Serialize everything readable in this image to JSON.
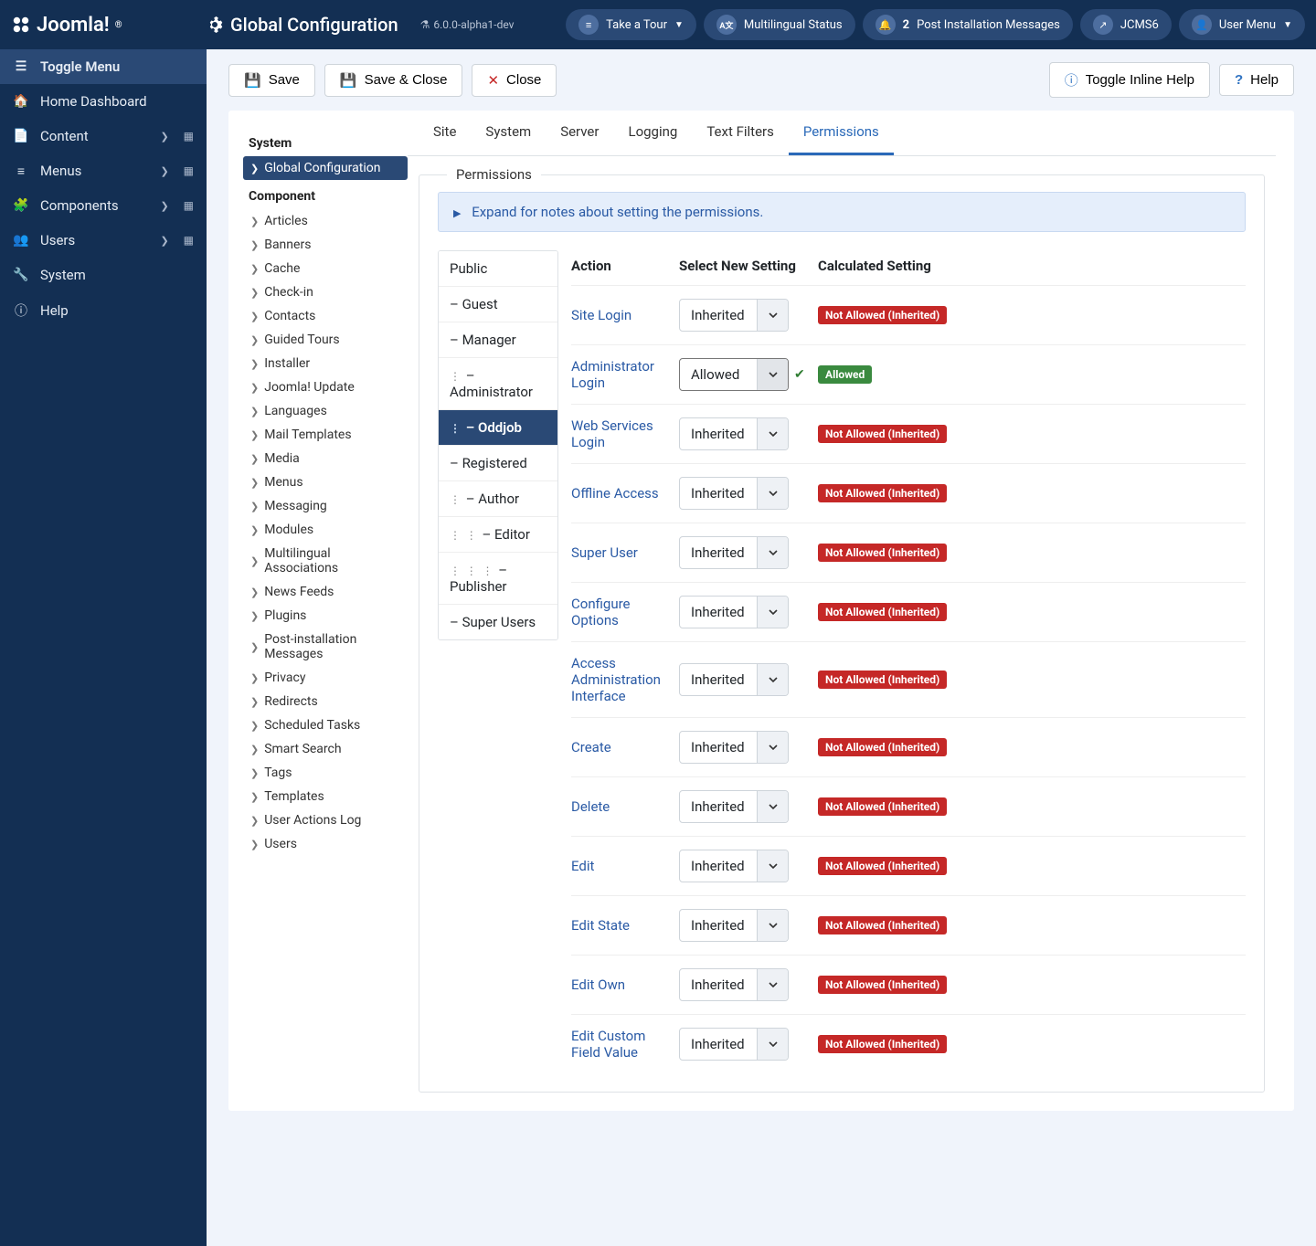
{
  "brand": "Joomla!",
  "page_title": "Global Configuration",
  "version": "6.0.0-alpha1-dev",
  "header_pills": {
    "tour": "Take a Tour",
    "multilingual": "Multilingual Status",
    "post_install_count": "2",
    "post_install": "Post Installation Messages",
    "site_link": "JCMS6",
    "user_menu": "User Menu"
  },
  "sidebar": [
    {
      "icon": "toggle",
      "label": "Toggle Menu",
      "toggle": true
    },
    {
      "icon": "home",
      "label": "Home Dashboard"
    },
    {
      "icon": "doc",
      "label": "Content",
      "sub": true
    },
    {
      "icon": "list",
      "label": "Menus",
      "sub": true
    },
    {
      "icon": "puzzle",
      "label": "Components",
      "sub": true
    },
    {
      "icon": "users",
      "label": "Users",
      "sub": true
    },
    {
      "icon": "wrench",
      "label": "System"
    },
    {
      "icon": "info",
      "label": "Help"
    }
  ],
  "toolbar": {
    "save": "Save",
    "save_close": "Save & Close",
    "close": "Close",
    "inline_help": "Toggle Inline Help",
    "help": "Help"
  },
  "left_nav": {
    "system_heading": "System",
    "system_active": "Global Configuration",
    "component_heading": "Component",
    "components": [
      "Articles",
      "Banners",
      "Cache",
      "Check-in",
      "Contacts",
      "Guided Tours",
      "Installer",
      "Joomla! Update",
      "Languages",
      "Mail Templates",
      "Media",
      "Menus",
      "Messaging",
      "Modules",
      "Multilingual Associations",
      "News Feeds",
      "Plugins",
      "Post-installation Messages",
      "Privacy",
      "Redirects",
      "Scheduled Tasks",
      "Smart Search",
      "Tags",
      "Templates",
      "User Actions Log",
      "Users"
    ]
  },
  "tabs": [
    "Site",
    "System",
    "Server",
    "Logging",
    "Text Filters",
    "Permissions"
  ],
  "active_tab": "Permissions",
  "fieldset_legend": "Permissions",
  "expand_note": "Expand for notes about setting the permissions.",
  "groups": [
    {
      "label": "Public",
      "indent": 0
    },
    {
      "label": "– Guest",
      "indent": 0,
      "tree": false
    },
    {
      "label": "– Manager",
      "indent": 0,
      "tree": false
    },
    {
      "label": "– Administrator",
      "indent": 1,
      "tree": true
    },
    {
      "label": "– Oddjob",
      "indent": 1,
      "tree": true,
      "active": true
    },
    {
      "label": "– Registered",
      "indent": 0
    },
    {
      "label": "– Author",
      "indent": 1,
      "tree": true
    },
    {
      "label": "– Editor",
      "indent": 2,
      "tree": true
    },
    {
      "label": "– Publisher",
      "indent": 3,
      "tree": true
    },
    {
      "label": "– Super Users",
      "indent": 0
    }
  ],
  "perm_headers": {
    "action": "Action",
    "select": "Select New Setting",
    "calc": "Calculated Setting"
  },
  "perm_rows": [
    {
      "action": "Site Login",
      "select": "Inherited",
      "calc": "Not Allowed (Inherited)",
      "calc_type": "red"
    },
    {
      "action": "Administrator Login",
      "select": "Allowed",
      "calc": "Allowed",
      "calc_type": "green",
      "checked": true
    },
    {
      "action": "Web Services Login",
      "select": "Inherited",
      "calc": "Not Allowed (Inherited)",
      "calc_type": "red"
    },
    {
      "action": "Offline Access",
      "select": "Inherited",
      "calc": "Not Allowed (Inherited)",
      "calc_type": "red"
    },
    {
      "action": "Super User",
      "select": "Inherited",
      "calc": "Not Allowed (Inherited)",
      "calc_type": "red"
    },
    {
      "action": "Configure Options",
      "select": "Inherited",
      "calc": "Not Allowed (Inherited)",
      "calc_type": "red"
    },
    {
      "action": "Access Administration Interface",
      "select": "Inherited",
      "calc": "Not Allowed (Inherited)",
      "calc_type": "red"
    },
    {
      "action": "Create",
      "select": "Inherited",
      "calc": "Not Allowed (Inherited)",
      "calc_type": "red"
    },
    {
      "action": "Delete",
      "select": "Inherited",
      "calc": "Not Allowed (Inherited)",
      "calc_type": "red"
    },
    {
      "action": "Edit",
      "select": "Inherited",
      "calc": "Not Allowed (Inherited)",
      "calc_type": "red"
    },
    {
      "action": "Edit State",
      "select": "Inherited",
      "calc": "Not Allowed (Inherited)",
      "calc_type": "red"
    },
    {
      "action": "Edit Own",
      "select": "Inherited",
      "calc": "Not Allowed (Inherited)",
      "calc_type": "red"
    },
    {
      "action": "Edit Custom Field Value",
      "select": "Inherited",
      "calc": "Not Allowed (Inherited)",
      "calc_type": "red"
    }
  ]
}
